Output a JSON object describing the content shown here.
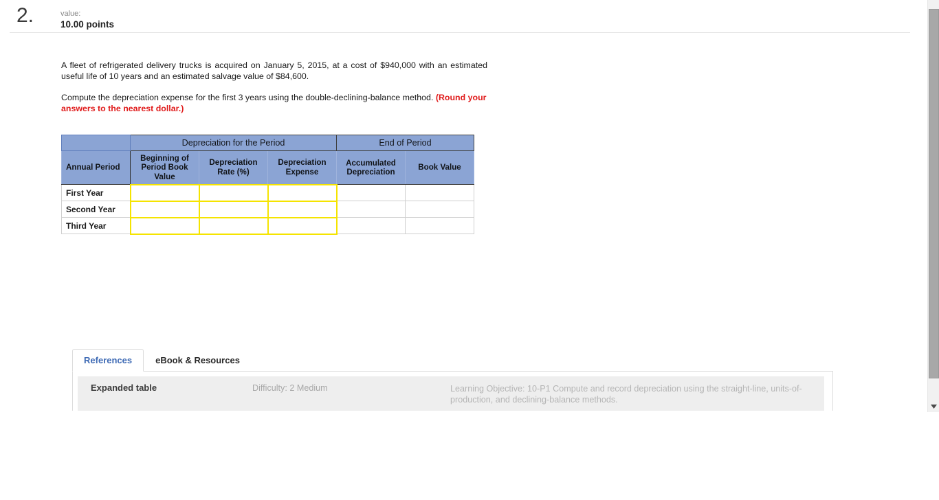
{
  "question": {
    "number": "2.",
    "value_label": "value:",
    "points": "10.00 points",
    "paragraph1": "A fleet of refrigerated delivery trucks is acquired on January 5, 2015, at a cost of $940,000 with an estimated useful life of 10 years and an estimated salvage value of $84,600.",
    "paragraph2_main": "Compute the depreciation expense for the first 3 years using the double-declining-balance method. ",
    "paragraph2_emphasis": "(Round your answers to the nearest dollar.)"
  },
  "table": {
    "group_headers": [
      {
        "label": "",
        "span": 1
      },
      {
        "label": "Depreciation for the Period",
        "span": 3
      },
      {
        "label": "End of Period",
        "span": 2
      }
    ],
    "column_headers": [
      "Annual Period",
      "Beginning of Period Book Value",
      "Depreciation Rate (%)",
      "Depreciation Expense",
      "Accumulated Depreciation",
      "Book Value"
    ],
    "column_headers_lines": {
      "annual_period": [
        "Annual Period"
      ],
      "beginning_book_value": [
        "Beginning of",
        "Period Book",
        "Value"
      ],
      "depreciation_rate": [
        "Depreciation",
        "Rate (%)"
      ],
      "depreciation_expense": [
        "Depreciation",
        "Expense"
      ],
      "accumulated_depreciation": [
        "Accumulated",
        "Depreciation"
      ],
      "book_value": [
        "Book Value"
      ]
    },
    "rows": [
      {
        "period": "First Year",
        "beginning_book_value": "",
        "depreciation_rate": "",
        "depreciation_expense": "",
        "accumulated_depreciation": "",
        "book_value": ""
      },
      {
        "period": "Second Year",
        "beginning_book_value": "",
        "depreciation_rate": "",
        "depreciation_expense": "",
        "accumulated_depreciation": "",
        "book_value": ""
      },
      {
        "period": "Third Year",
        "beginning_book_value": "",
        "depreciation_rate": "",
        "depreciation_expense": "",
        "accumulated_depreciation": "",
        "book_value": ""
      }
    ],
    "colors": {
      "header_blue": "#8ba4d4",
      "input_border_yellow": "#f5e400",
      "cell_border_gray": "#cfcfcf"
    }
  },
  "tabs": [
    {
      "label": "References",
      "active": true
    },
    {
      "label": "eBook & Resources",
      "active": false
    }
  ],
  "references": {
    "title": "Expanded table",
    "difficulty": "Difficulty: 2 Medium",
    "learning_objective": "Learning Objective: 10-P1 Compute and record depreciation using the straight-line, units-of-production, and declining-balance methods."
  },
  "scrollbar": {
    "down_arrow_icon": "chevron-down-icon"
  }
}
